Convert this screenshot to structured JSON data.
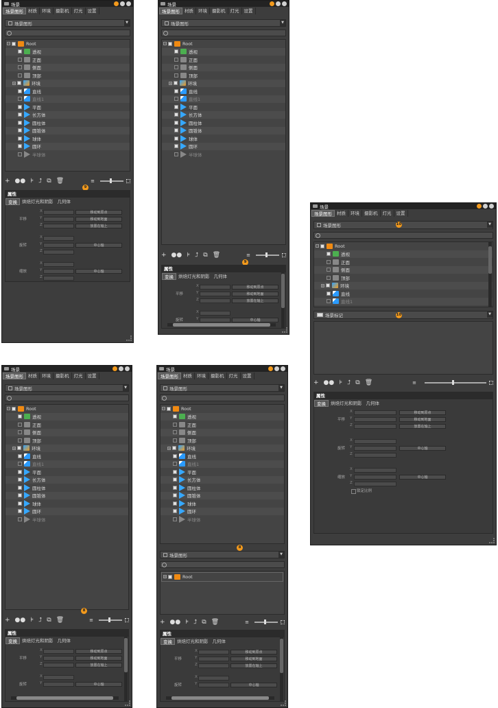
{
  "window_title": "场景",
  "tabs": [
    "场景图形",
    "材质",
    "环境",
    "摄影机",
    "灯光",
    "设置"
  ],
  "scene_graph_dropdown": "场景图形",
  "scene_marks_dropdown": "场景标记",
  "tree_items": [
    {
      "label": "Root",
      "icon": "root-icon"
    },
    {
      "label": "透视",
      "icon": "perspective-camera-icon"
    },
    {
      "label": "正面",
      "icon": "front-view-icon"
    },
    {
      "label": "侧面",
      "icon": "side-view-icon"
    },
    {
      "label": "顶部",
      "icon": "top-view-icon"
    },
    {
      "label": "环境",
      "icon": "environment-icon"
    },
    {
      "label": "直线",
      "icon": "line-icon"
    },
    {
      "label": "直线1",
      "icon": "line-icon"
    },
    {
      "label": "平面",
      "icon": "plane-icon"
    },
    {
      "label": "长方体",
      "icon": "box-icon"
    },
    {
      "label": "圆柱体",
      "icon": "cylinder-icon"
    },
    {
      "label": "圆锥体",
      "icon": "cone-icon"
    },
    {
      "label": "球体",
      "icon": "sphere-icon"
    },
    {
      "label": "圆环",
      "icon": "torus-icon"
    },
    {
      "label": "半球体",
      "icon": "hemisphere-icon"
    }
  ],
  "properties_title": "属性",
  "property_tabs": [
    "变换",
    "烘焙灯光和阴影",
    "几何体"
  ],
  "property_groups": [
    "平移",
    "旋转",
    "缩放"
  ],
  "axes": [
    "X",
    "Y",
    "Z"
  ],
  "translate_buttons": [
    "移动到原点",
    "移动到地面",
    "放置在轴上"
  ],
  "rotate_button": "中心轴",
  "scale_button": "中心轴",
  "lock_label": "锁定比例",
  "root_only_label": "Root",
  "badges": {
    "b9": "9",
    "b8": "8",
    "b10": "10"
  },
  "colors": {
    "accent": "#f39a1c",
    "panel": "#3d3d3d",
    "dark": "#232323"
  }
}
